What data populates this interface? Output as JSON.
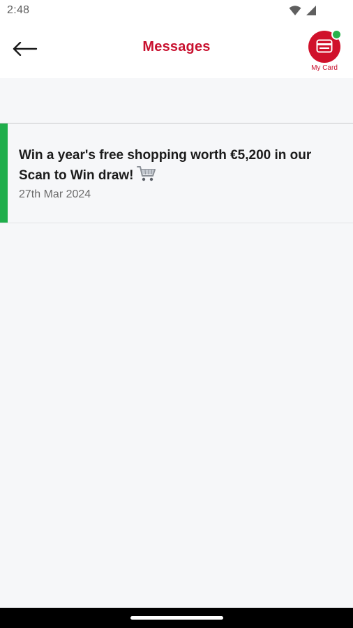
{
  "status_bar": {
    "time": "2:48",
    "icons": [
      "wifi-icon",
      "signal-icon"
    ]
  },
  "header": {
    "title": "Messages",
    "back_icon": "arrow-left-icon",
    "my_card": {
      "label": "My Card",
      "icon": "card-icon",
      "notification_dot_color": "#27b24a"
    }
  },
  "messages": [
    {
      "title": "Win a year's free shopping worth €5,200 in our Scan to Win draw!",
      "icon": "shopping-cart-icon",
      "date": "27th Mar 2024",
      "unread": true
    }
  ],
  "colors": {
    "brand_red": "#c8102e",
    "unread_green": "#1fae4b",
    "background": "#f6f7f9"
  }
}
